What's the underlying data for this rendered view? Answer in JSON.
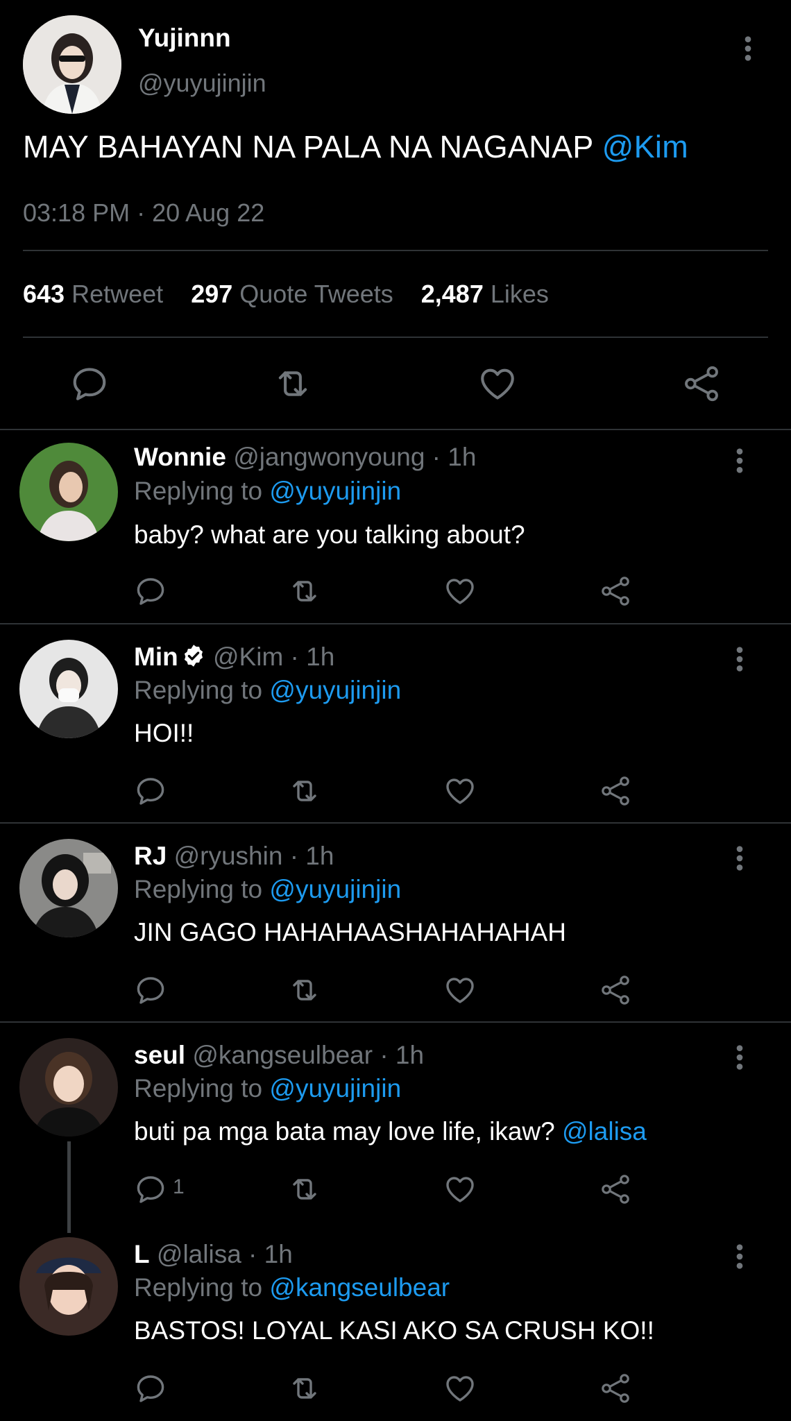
{
  "main_tweet": {
    "name": "Yujinnn",
    "handle": "@yuyujinjin",
    "text": "MAY BAHAYAN NA PALA NA NAGANAP ",
    "mention": "@Kim",
    "timestamp": "03:18 PM · 20 Aug 22",
    "stats": {
      "retweets": "643",
      "retweets_label": "Retweet",
      "quotes": "297",
      "quotes_label": "Quote Tweets",
      "likes": "2,487",
      "likes_label": "Likes"
    }
  },
  "replies": [
    {
      "name": "Wonnie",
      "handle": "@jangwonyoung · 1h",
      "replying_label": "Replying to ",
      "replying_to": "@yuyujinjin",
      "text": "baby? what are you talking about?",
      "text_mention": ""
    },
    {
      "name": "Min",
      "verified": true,
      "handle": "@Kim · 1h",
      "replying_label": "Replying to ",
      "replying_to": "@yuyujinjin",
      "text": "HOI!!",
      "text_mention": ""
    },
    {
      "name": "RJ",
      "handle": "@ryushin · 1h",
      "replying_label": "Replying to ",
      "replying_to": "@yuyujinjin",
      "text": "JIN GAGO HAHAHAASHAHAHAHAH",
      "text_mention": ""
    },
    {
      "name": "seul",
      "handle": "@kangseulbear · 1h",
      "replying_label": "Replying to ",
      "replying_to": "@yuyujinjin",
      "text": "buti pa mga bata may love life, ikaw? ",
      "text_mention": "@lalisa",
      "reply_count": "1"
    },
    {
      "name": "L",
      "handle": "@lalisa · 1h",
      "replying_label": "Replying to ",
      "replying_to": "@kangseulbear",
      "text": "BASTOS! LOYAL KASI AKO SA CRUSH KO!!",
      "text_mention": ""
    }
  ],
  "colors": {
    "background": "#000000",
    "link": "#1d9bf0",
    "muted": "#71767b",
    "divider": "#2f3336",
    "text": "#e7e9ea"
  },
  "icons": [
    "reply-icon",
    "retweet-icon",
    "like-icon",
    "share-icon",
    "more-icon",
    "verified-badge-icon"
  ]
}
